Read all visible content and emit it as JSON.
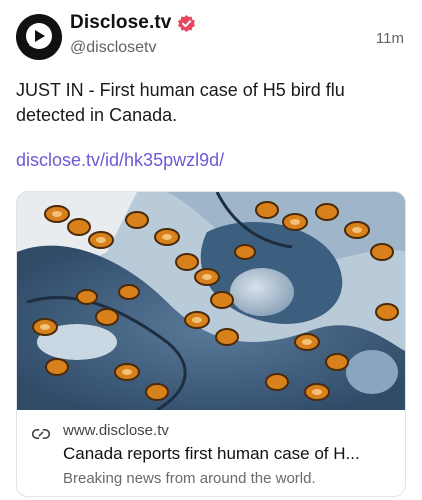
{
  "post": {
    "author": {
      "display_name": "Disclose.tv",
      "handle": "@disclosetv",
      "avatar_icon": "play-bubble-icon",
      "verified_icon": "verified-badge-icon",
      "verified_color": "#e8475f"
    },
    "timestamp": "11m",
    "text": "JUST IN - First human case of H5 bird flu detected in Canada.",
    "link_text": "disclose.tv/id/hk35pwzl9d/",
    "link_color": "#6b5bd6"
  },
  "card": {
    "image_alt": "Microscope image of H5 bird flu virus particles",
    "domain": "www.disclose.tv",
    "title": "Canada reports first human case of H...",
    "description": "Breaking news from around the world.",
    "link_icon": "link-icon"
  }
}
